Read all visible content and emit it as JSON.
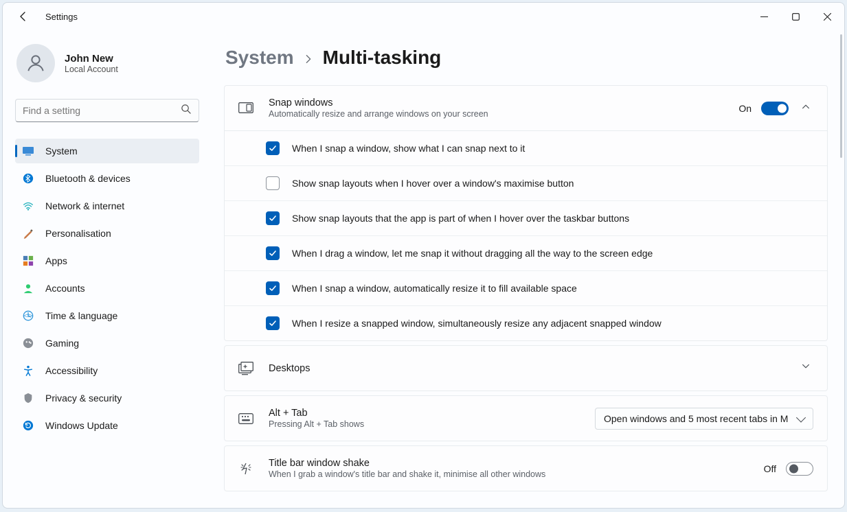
{
  "app_title": "Settings",
  "user": {
    "name": "John New",
    "sub": "Local Account"
  },
  "search": {
    "placeholder": "Find a setting"
  },
  "nav": [
    {
      "label": "System"
    },
    {
      "label": "Bluetooth & devices"
    },
    {
      "label": "Network & internet"
    },
    {
      "label": "Personalisation"
    },
    {
      "label": "Apps"
    },
    {
      "label": "Accounts"
    },
    {
      "label": "Time & language"
    },
    {
      "label": "Gaming"
    },
    {
      "label": "Accessibility"
    },
    {
      "label": "Privacy & security"
    },
    {
      "label": "Windows Update"
    }
  ],
  "breadcrumb": {
    "parent": "System",
    "current": "Multi-tasking"
  },
  "snap": {
    "title": "Snap windows",
    "sub": "Automatically resize and arrange windows on your screen",
    "state_label": "On",
    "options": [
      {
        "label": "When I snap a window, show what I can snap next to it"
      },
      {
        "label": "Show snap layouts when I hover over a window's maximise button"
      },
      {
        "label": "Show snap layouts that the app is part of when I hover over the taskbar buttons"
      },
      {
        "label": "When I drag a window, let me snap it without dragging all the way to the screen edge"
      },
      {
        "label": "When I snap a window, automatically resize it to fill available space"
      },
      {
        "label": "When I resize a snapped window, simultaneously resize any adjacent snapped window"
      }
    ]
  },
  "desktops": {
    "title": "Desktops"
  },
  "alttab": {
    "title": "Alt + Tab",
    "sub": "Pressing Alt + Tab shows",
    "selected": "Open windows and 5 most recent tabs in M"
  },
  "shake": {
    "title": "Title bar window shake",
    "sub": "When I grab a window's title bar and shake it, minimise all other windows",
    "state_label": "Off"
  }
}
